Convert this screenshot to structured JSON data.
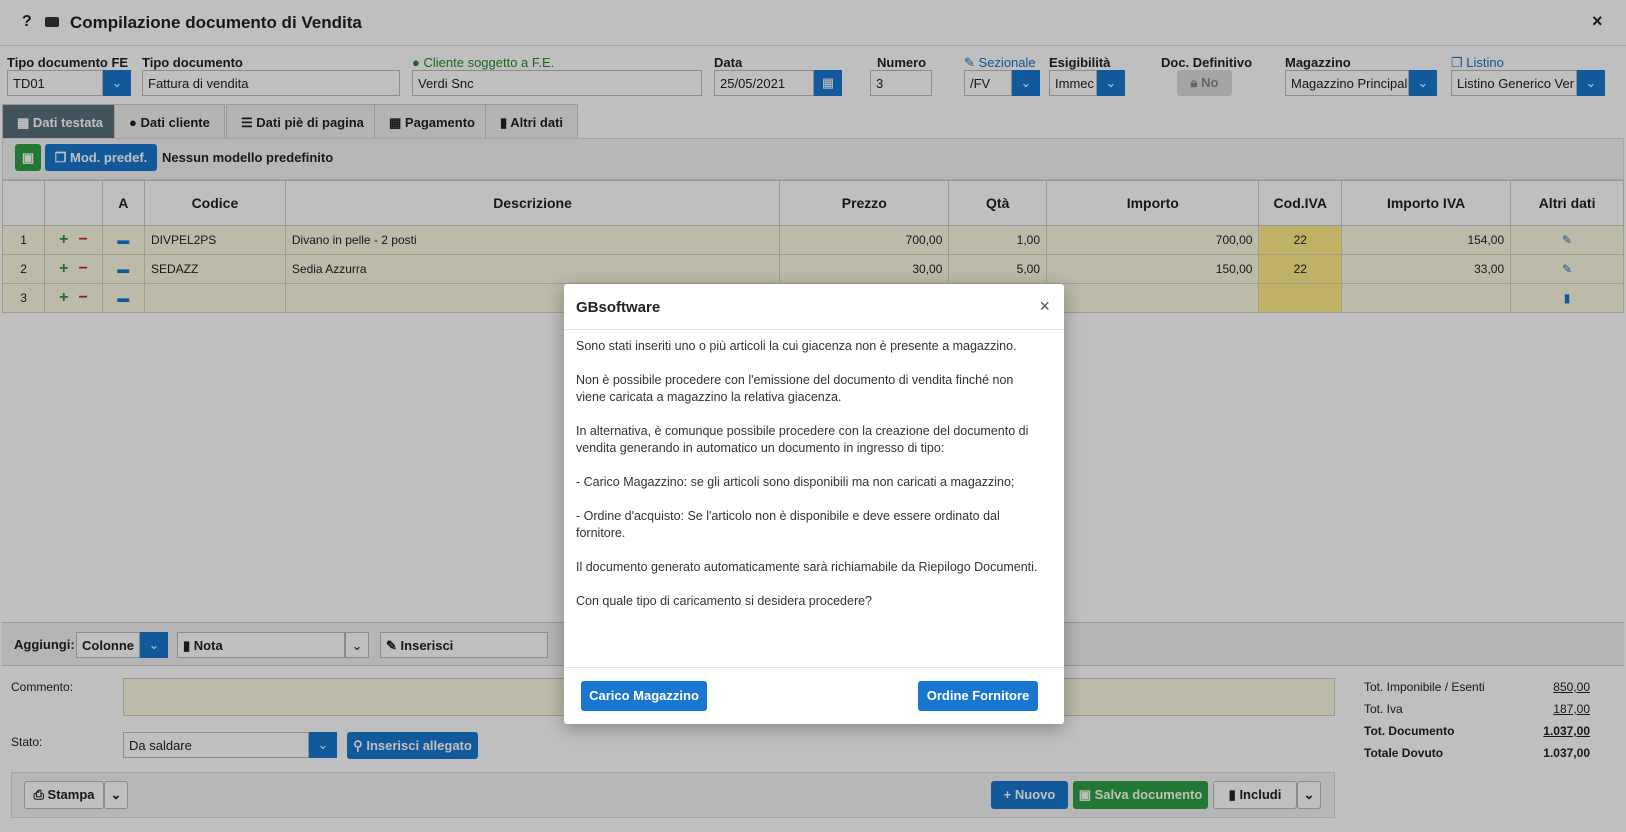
{
  "window": {
    "title": "Compilazione documento di Vendita",
    "help": "?",
    "close": "×"
  },
  "header": {
    "tipo_fe_label": "Tipo documento FE",
    "tipo_fe_value": "TD01",
    "tipo_doc_label": "Tipo documento",
    "tipo_doc_value": "Fattura di vendita",
    "cliente_label": "Cliente soggetto a F.E.",
    "cliente_value": "Verdi Snc",
    "data_label": "Data",
    "data_value": "25/05/2021",
    "numero_label": "Numero",
    "numero_value": "3",
    "sezionale_label": "Sezionale",
    "sezionale_value": "/FV",
    "esigibilita_label": "Esigibilità",
    "esigibilita_value": "Immec",
    "definitivo_label": "Doc. Definitivo",
    "definitivo_value": "No",
    "magazzino_label": "Magazzino",
    "magazzino_value": "Magazzino Principal",
    "listino_label": "Listino",
    "listino_value": "Listino Generico Ver"
  },
  "tabs": [
    "Dati testata",
    "Dati cliente",
    "Dati piè di pagina",
    "Pagamento",
    "Altri dati"
  ],
  "toolbar": {
    "mod_predef": "Mod. predef.",
    "nessun_modello": "Nessun modello predefinito"
  },
  "grid": {
    "columns": [
      "",
      "",
      "A",
      "Codice",
      "Descrizione",
      "Prezzo",
      "Qtà",
      "Importo",
      "Cod.IVA",
      "Importo IVA",
      "Altri dati"
    ],
    "rows": [
      {
        "n": "1",
        "codice": "DIVPEL2PS",
        "descrizione": "Divano in pelle - 2 posti",
        "prezzo": "700,00",
        "qta": "1,00",
        "importo": "700,00",
        "codiva": "22",
        "importo_iva": "154,00"
      },
      {
        "n": "2",
        "codice": "SEDAZZ",
        "descrizione": "Sedia Azzurra",
        "prezzo": "30,00",
        "qta": "5,00",
        "importo": "150,00",
        "codiva": "22",
        "importo_iva": "33,00"
      },
      {
        "n": "3",
        "codice": "",
        "descrizione": "",
        "prezzo": "",
        "qta": "",
        "importo": "",
        "codiva": "",
        "importo_iva": ""
      }
    ]
  },
  "aggiungi": {
    "label": "Aggiungi:",
    "colonne": "Colonne",
    "nota": "Nota",
    "inserisci": "Inserisci"
  },
  "footer": {
    "commento_label": "Commento:",
    "stato_label": "Stato:",
    "stato_value": "Da saldare",
    "inserisci_allegato": "Inserisci allegato",
    "stampa": "Stampa",
    "nuovo": "Nuovo",
    "salva": "Salva documento",
    "includi": "Includi"
  },
  "totals": [
    {
      "label": "Tot. Imponibile / Esenti",
      "value": "850,00"
    },
    {
      "label": "Tot. Iva",
      "value": "187,00"
    },
    {
      "label": "Tot. Documento",
      "value": "1.037,00"
    },
    {
      "label": "Totale Dovuto",
      "value": "1.037,00"
    }
  ],
  "modal": {
    "title": "GBsoftware",
    "paragraphs": [
      "Sono stati inseriti uno o più articoli la cui giacenza non è presente a magazzino.",
      "Non è possibile procedere con l'emissione del documento di vendita finché non viene caricata a magazzino la relativa giacenza.",
      "In alternativa, è comunque possibile procedere con la creazione del documento di vendita generando in automatico un documento in ingresso di tipo:",
      "- Carico Magazzino: se gli articoli sono disponibili ma non caricati a magazzino;",
      "- Ordine d'acquisto: Se l'articolo non è disponibile e deve essere ordinato dal fornitore.",
      "Il documento generato automaticamente sarà richiamabile da Riepilogo Documenti.",
      "Con quale tipo di caricamento si desidera procedere?"
    ],
    "btn_carico": "Carico Magazzino",
    "btn_ordine": "Ordine Fornitore"
  }
}
